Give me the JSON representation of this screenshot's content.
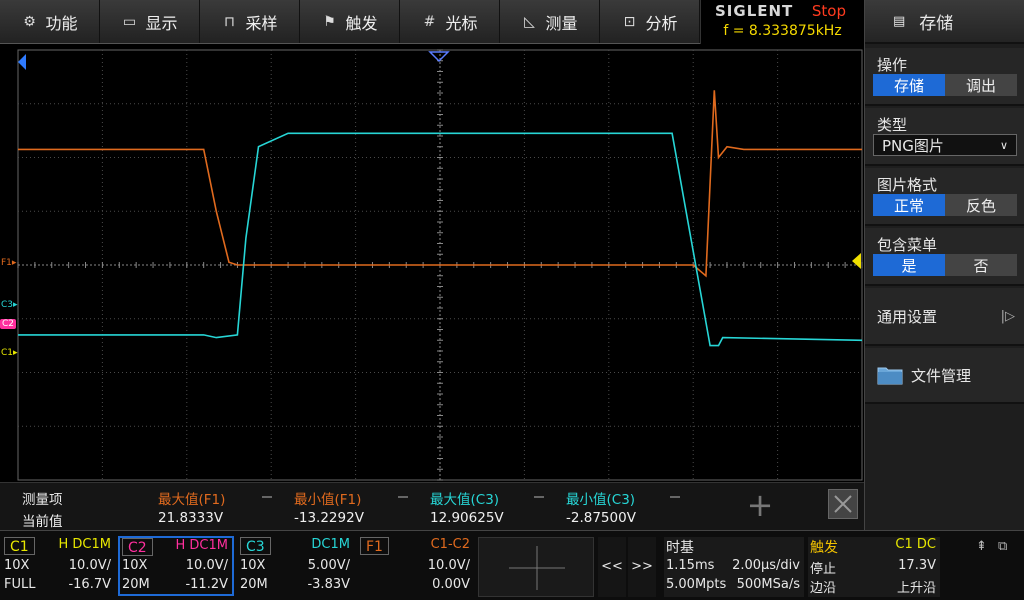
{
  "menu": [
    {
      "icon": "gear",
      "label": "功能"
    },
    {
      "icon": "monitor",
      "label": "显示"
    },
    {
      "icon": "wave",
      "label": "采样"
    },
    {
      "icon": "flag",
      "label": "触发"
    },
    {
      "icon": "crosshair",
      "label": "光标"
    },
    {
      "icon": "ruler",
      "label": "测量"
    },
    {
      "icon": "analyze",
      "label": "分析"
    }
  ],
  "brand": {
    "logo": "SIGLENT",
    "state": "Stop",
    "freq": "f = 8.333875kHz"
  },
  "panel": {
    "title": "存储",
    "op_label": "操作",
    "op_save": "存储",
    "op_recall": "调出",
    "type_label": "类型",
    "type_value": "PNG图片",
    "format_label": "图片格式",
    "fmt_normal": "正常",
    "fmt_invert": "反色",
    "menu_label": "包含菜单",
    "menu_yes": "是",
    "menu_no": "否",
    "general": "通用设置",
    "files": "文件管理"
  },
  "markers": {
    "f1": "F1",
    "c3": "C3",
    "c2": "C2",
    "c1": "C1"
  },
  "measure": {
    "row1_label": "测量项",
    "row2_label": "当前值",
    "items": [
      {
        "name": "最大值(F1)",
        "value": "21.8333V"
      },
      {
        "name": "最小值(F1)",
        "value": "-13.2292V"
      },
      {
        "name": "最大值(C3)",
        "value": "12.90625V"
      },
      {
        "name": "最小值(C3)",
        "value": "-2.87500V"
      }
    ]
  },
  "channels": {
    "c1": {
      "name": "C1",
      "coupling": "H  DC1M",
      "probe": "10X",
      "scale": "10.0V/",
      "bw": "FULL",
      "offset": "-16.7V"
    },
    "c2": {
      "name": "C2",
      "coupling": "H  DC1M",
      "probe": "10X",
      "scale": "10.0V/",
      "bw": "20M",
      "offset": "-11.2V"
    },
    "c3": {
      "name": "C3",
      "coupling": "DC1M",
      "probe": "10X",
      "scale": "5.00V/",
      "bw": "20M",
      "offset": "-3.83V"
    },
    "f1": {
      "name": "F1",
      "expr": "C1-C2",
      "scale": "10.0V/",
      "offset": "0.00V"
    }
  },
  "nav": {
    "prev": "<<",
    "next": ">>"
  },
  "timebase": {
    "label": "时基",
    "delay": "1.15ms",
    "scale": "2.00µs/div",
    "points": "5.00Mpts",
    "rate": "500MSa/s"
  },
  "trigger": {
    "label": "触发",
    "source": "C1 DC",
    "state": "停止",
    "level": "17.3V",
    "type": "边沿",
    "slope": "上升沿"
  },
  "colors": {
    "c1": "#e8e800",
    "c2": "#ff2f9e",
    "c3": "#27d6d6",
    "f1": "#e06a1e",
    "accent": "#1e6ad6"
  },
  "chart_data": {
    "type": "line",
    "series": [
      {
        "name": "F1",
        "color": "#e06a1e",
        "x": [
          0,
          2.2,
          2.35,
          2.5,
          2.6,
          8.0,
          8.15,
          8.25,
          8.3,
          8.4,
          8.6,
          10.0
        ],
        "y": [
          2.15,
          2.15,
          1.0,
          0.05,
          0.0,
          0.0,
          -0.2,
          3.25,
          2.0,
          2.2,
          2.15,
          2.15
        ]
      },
      {
        "name": "C3",
        "color": "#27d6d6",
        "x": [
          0,
          2.2,
          2.35,
          2.6,
          2.7,
          2.85,
          3.2,
          7.65,
          7.75,
          8.2,
          8.3,
          8.35,
          10.0
        ],
        "y": [
          -1.3,
          -1.3,
          -1.35,
          -1.3,
          0.5,
          2.2,
          2.45,
          2.45,
          2.45,
          -1.5,
          -1.5,
          -1.35,
          -1.4
        ]
      }
    ]
  }
}
